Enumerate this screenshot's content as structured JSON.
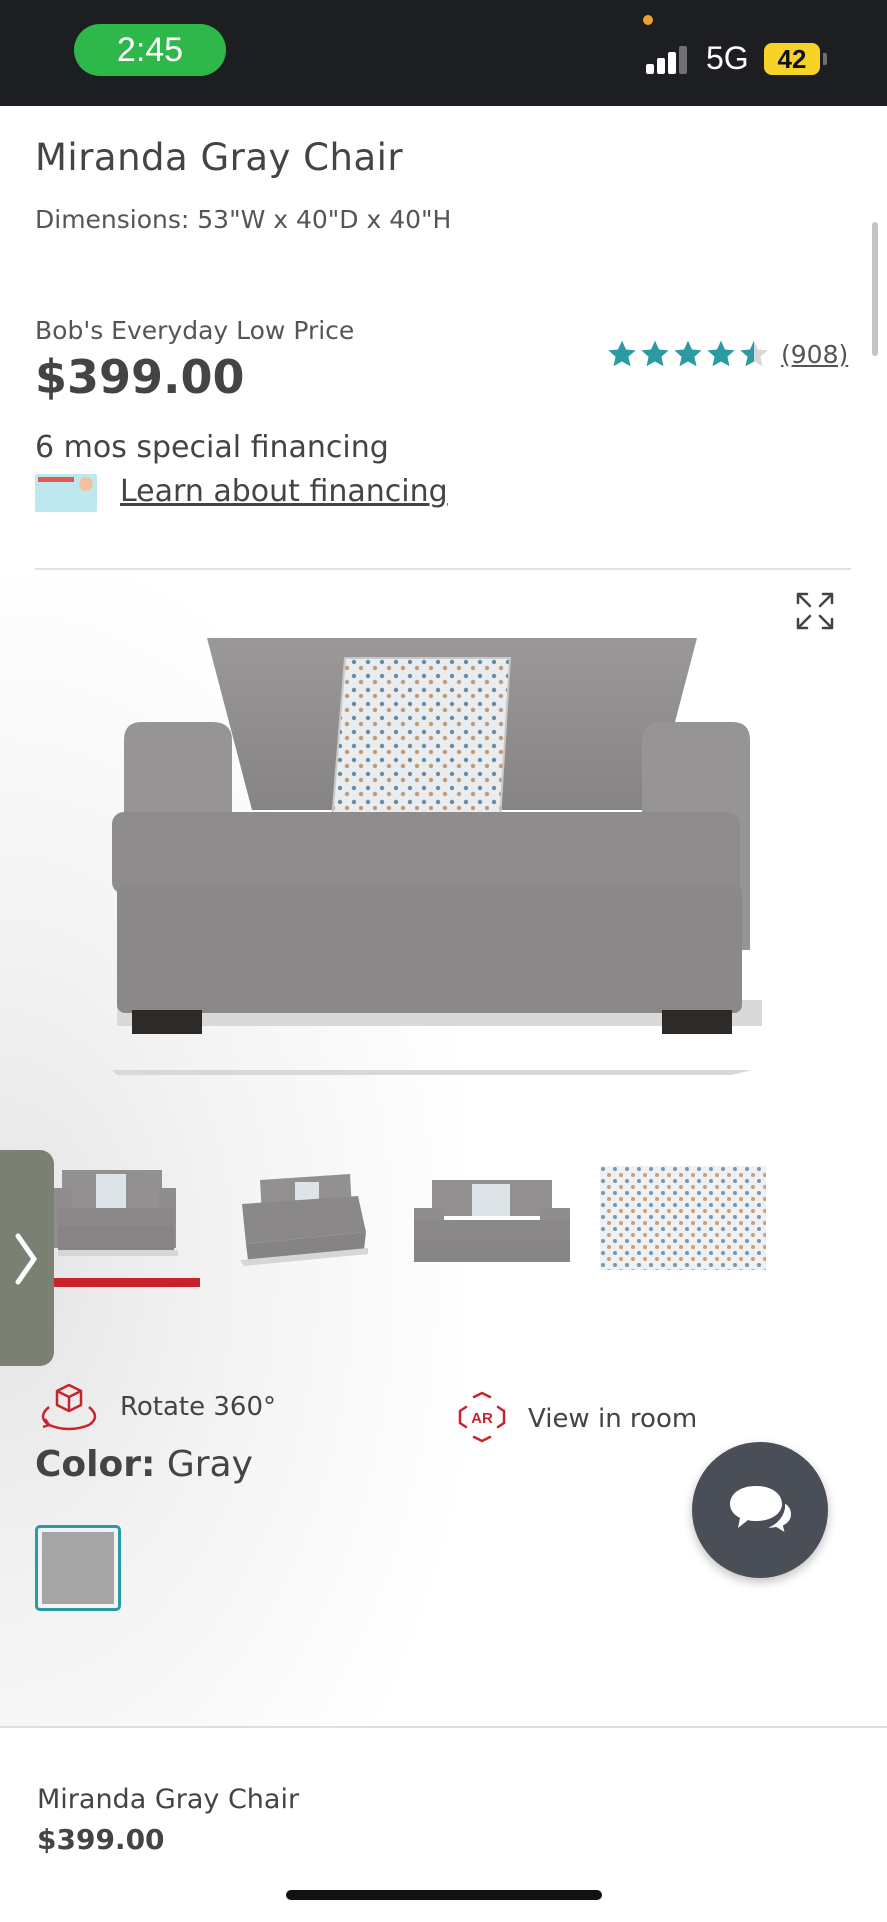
{
  "status_bar": {
    "time": "2:45",
    "network": "5G",
    "battery": "42"
  },
  "product": {
    "title": "Miranda Gray Chair",
    "dimensions": "Dimensions: 53\"W x 40\"D x 40\"H",
    "price_label": "Bob's Everyday Low Price",
    "price": "$399.00",
    "rating": {
      "stars": 4.5,
      "max": 5,
      "count_label": "(908)"
    },
    "financing": {
      "title": "6 mos special financing",
      "link": "Learn about financing"
    }
  },
  "gallery": {
    "thumbnails": [
      "thumbnail-front",
      "thumbnail-angle",
      "thumbnail-side",
      "thumbnail-fabric"
    ],
    "selected_index": 0
  },
  "actions": {
    "rotate_label": "Rotate 360°",
    "ar_label": "View in room",
    "ar_icon_text": "AR"
  },
  "color": {
    "label": "Color:",
    "value": "Gray",
    "swatch": "#a5a5a5"
  },
  "bottom_bar": {
    "name": "Miranda Gray Chair",
    "price": "$399.00"
  },
  "colors": {
    "accent_red": "#c8232c",
    "star_teal": "#2a9aa5",
    "chat_bg": "#4a4e56"
  }
}
